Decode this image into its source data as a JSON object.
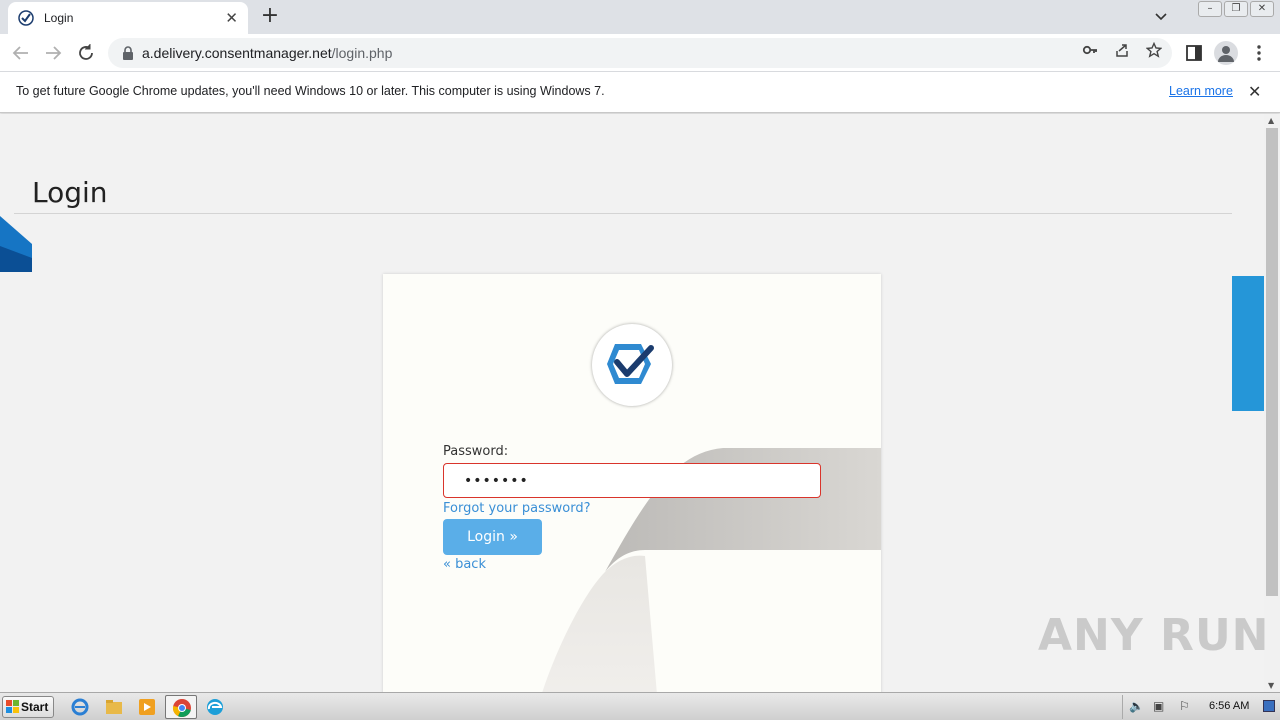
{
  "browser": {
    "tab_title": "Login",
    "tab_close": "✕",
    "new_tab": "+",
    "url_host": "a.delivery.consentmanager.net",
    "url_path": "/login.php"
  },
  "infobar": {
    "message": "To get future Google Chrome updates, you'll need Windows 10 or later. This computer is using Windows 7.",
    "learn_more": "Learn more",
    "close": "✕"
  },
  "page": {
    "heading": "Login",
    "password_label": "Password:",
    "password_value": "•••••••",
    "forgot_link": "Forgot your password?",
    "login_button": "Login »",
    "back_link": "« back"
  },
  "watermark": "ANY RUN",
  "taskbar": {
    "start_label": "Start",
    "clock": "6:56 AM"
  },
  "colors": {
    "brand_blue": "#2596d8",
    "button_blue": "#5aaee8",
    "error_red": "#d9342b",
    "logo_navy": "#1b3c6e"
  },
  "icons": [
    "back-arrow-icon",
    "forward-arrow-icon",
    "reload-icon",
    "lock-icon",
    "key-icon",
    "share-icon",
    "star-icon",
    "sidepanel-icon",
    "profile-icon",
    "menu-icon",
    "chevron-down-icon",
    "ie-icon",
    "folder-icon",
    "media-icon",
    "chrome-icon",
    "edge-icon"
  ]
}
